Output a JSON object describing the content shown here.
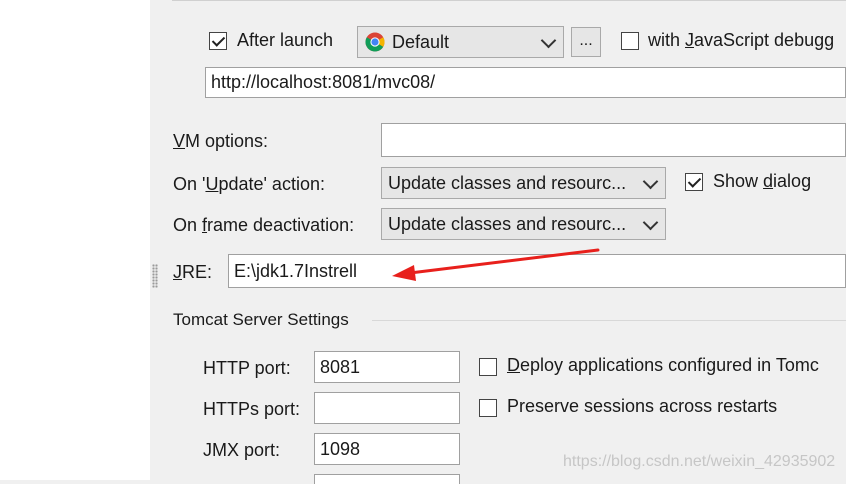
{
  "browser": {
    "after_launch_label": "After launch",
    "after_launch_checked": true,
    "browser_select": "Default",
    "browse_button_label": "...",
    "js_debug_label": "with JavaScript debugg",
    "url": "http://localhost:8081/mvc08/"
  },
  "vm_options": {
    "label": "VM options:",
    "value": ""
  },
  "on_update": {
    "label": "On 'Update' action:",
    "value": "Update classes and resourc...",
    "show_dialog_label": "Show dialog",
    "show_dialog_checked": true
  },
  "on_frame_deactivation": {
    "label": "On frame deactivation:",
    "value": "Update classes and resourc..."
  },
  "jre": {
    "label": "JRE:",
    "value": "E:\\jdk1.7Instrell"
  },
  "tomcat": {
    "section_title": "Tomcat Server Settings",
    "http_port_label": "HTTP port:",
    "http_port_value": "8081",
    "https_port_label": "HTTPs port:",
    "https_port_value": "",
    "jmx_port_label": "JMX port:",
    "jmx_port_value": "1098",
    "deploy_label": "Deploy applications configured in Tomc",
    "deploy_checked": false,
    "preserve_label": "Preserve sessions across restarts",
    "preserve_checked": false
  },
  "colors": {
    "annotation_arrow": "#e8201c",
    "text": "#1a1a1a"
  },
  "icons": {
    "browser_icon": "chrome-icon"
  },
  "watermark": "https://blog.csdn.net/weixin_42935902"
}
